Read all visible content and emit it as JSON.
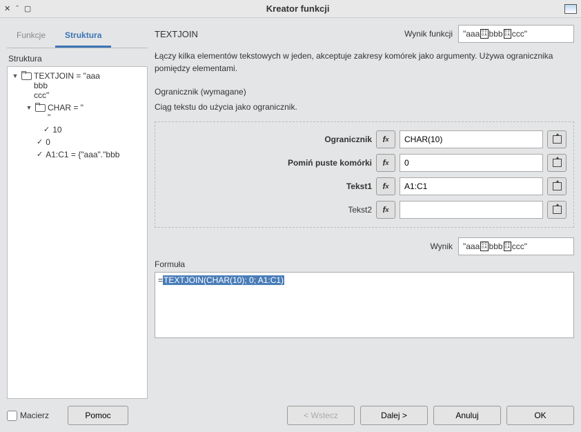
{
  "title": "Kreator funkcji",
  "tabs": {
    "funkcje": "Funkcje",
    "struktura": "Struktura"
  },
  "struct_label": "Struktura",
  "tree": {
    "root": "TEXTJOIN = \"aaa bbb ccc\"",
    "root_l1": "TEXTJOIN = \"aaa",
    "root_l2": "bbb",
    "root_l3": "ccc\"",
    "char": "CHAR = \"",
    "char_l2": "\"",
    "char_val": "10",
    "zero": "0",
    "range": "A1:C1 = {\"aaa\".\"bbb"
  },
  "func_name": "TEXTJOIN",
  "result_label": "Wynik funkcji",
  "result_value_parts": [
    "\"aaa",
    "bbb",
    "ccc\""
  ],
  "description": "Łączy kilka elementów tekstowych w jeden, akceptuje zakresy komórek jako argumenty. Używa ogranicznika pomiędzy elementami.",
  "current_param_title": "Ogranicznik (wymagane)",
  "current_param_desc": "Ciąg tekstu do użycia jako ogranicznik.",
  "params": [
    {
      "label": "Ogranicznik",
      "value": "CHAR(10)",
      "bold": true
    },
    {
      "label": "Pomiń puste komórki",
      "value": "0",
      "bold": true
    },
    {
      "label": "Tekst1",
      "value": "A1:C1",
      "bold": true
    },
    {
      "label": "Tekst2",
      "value": "",
      "bold": false
    }
  ],
  "wynik_label": "Wynik",
  "formula_label": "Formuła",
  "formula_prefix": "=",
  "formula_selected": "TEXTJOIN(CHAR(10); 0; A1:C1)",
  "matrix_label": "Macierz",
  "buttons": {
    "help": "Pomoc",
    "back": "< Wstecz",
    "next": "Dalej >",
    "cancel": "Anuluj",
    "ok": "OK"
  }
}
